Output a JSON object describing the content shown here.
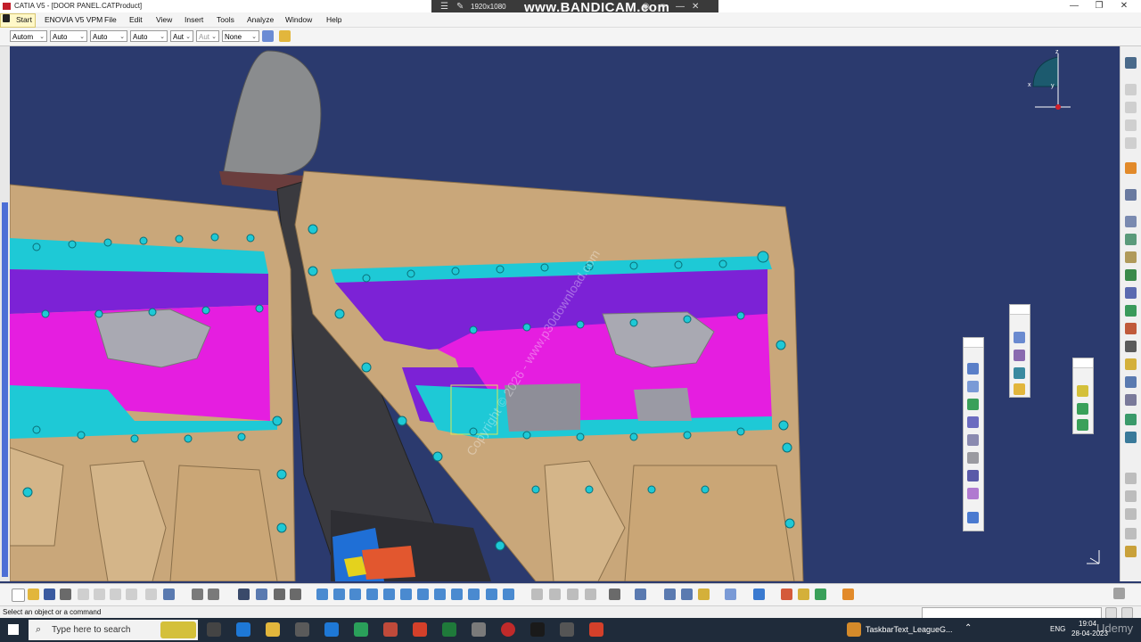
{
  "window": {
    "title": "CATIA V5 - [DOOR PANEL.CATProduct]",
    "controls": {
      "minimize": "—",
      "restore": "❐",
      "close": "✕"
    }
  },
  "recorder": {
    "resolution": "1920x1080",
    "brand": "www.BANDICAM.com"
  },
  "menu": {
    "items": [
      "Start",
      "ENOVIA V5 VPM",
      "File",
      "Edit",
      "View",
      "Insert",
      "Tools",
      "Analyze",
      "Window",
      "Help"
    ]
  },
  "toolbar_top": {
    "combos": [
      "Autom",
      "Auto",
      "Auto",
      "Auto",
      "Aut",
      "Aut",
      "None"
    ]
  },
  "viewport": {
    "background": "#2b3a6e",
    "watermark": "Copyright © 2026 - www.p30download.com",
    "compass_labels": {
      "z": "z",
      "x": "x",
      "y": "y"
    }
  },
  "status": {
    "text": "Select an object or a command"
  },
  "taskbar": {
    "search_placeholder": "Type here to search",
    "app_label": "TaskbarText_LeagueG...",
    "lang": "ENG",
    "time": "19:04",
    "date": "28-04-2023",
    "overlay_brand": "Udemy"
  },
  "colors": {
    "panel_tan": "#c9a77a",
    "purple": "#7c22d6",
    "magenta": "#e51ee0",
    "cyan": "#1ec9d6",
    "seat_gray": "#3a3a3f"
  }
}
